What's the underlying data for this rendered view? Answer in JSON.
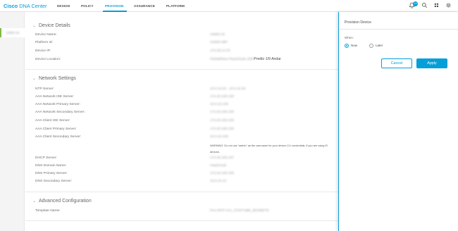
{
  "app": {
    "brand_bold": "Cisco",
    "brand_rest": " DNA Center",
    "nav": [
      "DESIGN",
      "POLICY",
      "PROVISION",
      "ASSURANCE",
      "PLATFORM"
    ],
    "active_nav": "PROVISION",
    "notification_count": "13"
  },
  "sidebar": {
    "device": "JX893-15"
  },
  "device_details": {
    "title": "Device Details",
    "rows": [
      {
        "label": "Device Name:",
        "value": "JX893-15"
      },
      {
        "label": "Platform Id:",
        "value": "C9300-48P"
      },
      {
        "label": "Device IP:",
        "value": "172.28.3.175"
      },
      {
        "label": "Device Location:",
        "value_blurred": "Global/New Plaza/Suite 250/",
        "value_clear": "Predio 1/9 Andar"
      }
    ]
  },
  "network_settings": {
    "title": "Network Settings",
    "rows": [
      {
        "label": "NTP Server:",
        "value": "10.0.10.20 , 10.0.10.30"
      },
      {
        "label": "AAA Network ISE Server:",
        "value": "172.20.100.100"
      },
      {
        "label": "AAA Network Primary Server:",
        "value": "10.0.10.100"
      },
      {
        "label": "AAA Network Secondary Server:",
        "value": "172.20.100.100"
      },
      {
        "label": "AAA Client ISE Server:",
        "value": "172.20.100.100"
      },
      {
        "label": "AAA Client Primary Server:",
        "value": "172.20.100.100"
      },
      {
        "label": "AAA Client Secondary Server:",
        "value": "10.0.10.100"
      },
      {
        "label": "DHCP Server:",
        "value": "172.20.100.107"
      },
      {
        "label": "DNS Domain Name:",
        "value": "rraad.local"
      },
      {
        "label": "DNS Primary Server:",
        "value": "172.20.100.100"
      },
      {
        "label": "DNS Secondary Server:",
        "value": "10.0.10.10"
      }
    ],
    "warning_line1": "WARNING: Do not use \"admin\" as the username for your device CLI credentials, if you are using IS",
    "warning_line2": "devices."
  },
  "advanced_configuration": {
    "title": "Advanced Configuration",
    "rows": [
      {
        "label": "Template Name:",
        "value": "PnA-RFP-ACL_POSTUBE_BOXBETE"
      }
    ]
  },
  "drawer": {
    "title": "Provision Device",
    "when_label": "When:",
    "options": [
      {
        "label": "Now",
        "checked": true
      },
      {
        "label": "Later",
        "checked": false
      }
    ],
    "cancel": "Cancel",
    "apply": "Apply"
  },
  "icons": [
    "notifications-icon",
    "search-icon",
    "apps-icon",
    "settings-icon",
    "chevron-down-icon"
  ],
  "colors": {
    "accent": "#049fd9",
    "selection": "#7fba42"
  }
}
